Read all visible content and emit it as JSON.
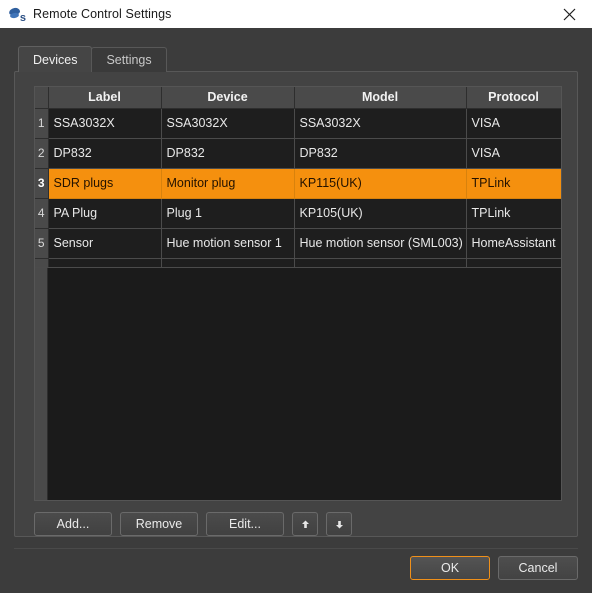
{
  "window": {
    "title": "Remote Control Settings",
    "icon": "app-icon",
    "close_label": "×"
  },
  "tabs": [
    {
      "label": "Devices",
      "active": true
    },
    {
      "label": "Settings",
      "active": false
    }
  ],
  "table": {
    "columns": [
      "Label",
      "Device",
      "Model",
      "Protocol"
    ],
    "rows": [
      {
        "num": "1",
        "label": "SSA3032X",
        "device": "SSA3032X",
        "model": "SSA3032X",
        "protocol": "VISA",
        "selected": false
      },
      {
        "num": "2",
        "label": "DP832",
        "device": "DP832",
        "model": "DP832",
        "protocol": "VISA",
        "selected": false
      },
      {
        "num": "3",
        "label": "SDR plugs",
        "device": "Monitor plug",
        "model": "KP115(UK)",
        "protocol": "TPLink",
        "selected": true
      },
      {
        "num": "4",
        "label": "PA Plug",
        "device": "Plug 1",
        "model": "KP105(UK)",
        "protocol": "TPLink",
        "selected": false
      },
      {
        "num": "5",
        "label": "Sensor",
        "device": "Hue motion sensor 1",
        "model": "Hue motion sensor (SML003)",
        "protocol": "HomeAssistant",
        "selected": false
      }
    ]
  },
  "actions": {
    "add_label": "Add...",
    "remove_label": "Remove",
    "edit_label": "Edit...",
    "move_up_icon": "arrow-up-icon",
    "move_down_icon": "arrow-down-icon"
  },
  "footer": {
    "ok_label": "OK",
    "cancel_label": "Cancel"
  },
  "colors": {
    "selection": "#f5900e",
    "accent": "#f0901a",
    "dialog_bg": "#3c3c3c",
    "panel_bg": "#434343",
    "table_bg": "#1e1e1e",
    "titlebar_bg": "#ffffff"
  }
}
